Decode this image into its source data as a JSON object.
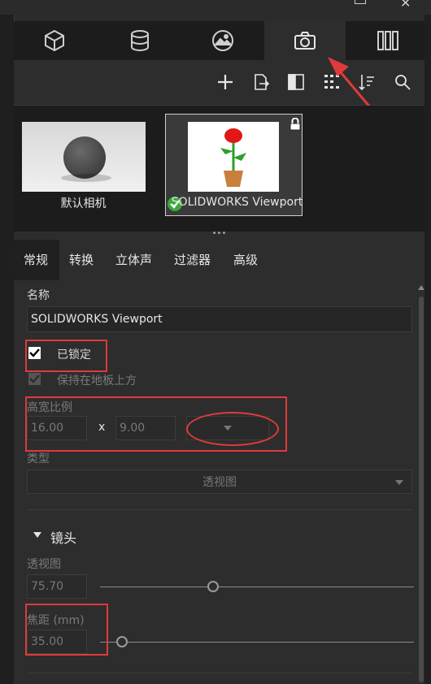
{
  "top_tabs": [
    {
      "name": "model-tab",
      "icon": "cube-icon"
    },
    {
      "name": "materials-tab",
      "icon": "cylinder-icon"
    },
    {
      "name": "environment-tab",
      "icon": "landscape-icon"
    },
    {
      "name": "cameras-tab",
      "icon": "camera-icon",
      "active": true
    },
    {
      "name": "library-tab",
      "icon": "library-icon"
    }
  ],
  "toolbar": {
    "icons": [
      "plus-icon",
      "export-icon",
      "split-view-icon",
      "tree-icon",
      "sort-icon",
      "search-icon"
    ]
  },
  "thumbnails": [
    {
      "label": "默认相机",
      "selected": false
    },
    {
      "label": "SOLIDWORKS Viewport",
      "selected": true,
      "locked": true
    }
  ],
  "prop_tabs": [
    "常规",
    "转换",
    "立体声",
    "过滤器",
    "高级"
  ],
  "general": {
    "name_label": "名称",
    "name_value": "SOLIDWORKS Viewport",
    "locked_label": "已锁定",
    "keep_floor_label": "保持在地板上方",
    "aspect_label": "高宽比例",
    "aspect_w": "16.00",
    "aspect_x": "x",
    "aspect_h": "9.00",
    "type_label": "类型",
    "type_value": "透视图",
    "lens_section": "镜头",
    "perspective_label": "透视图",
    "perspective_value": "75.70",
    "perspective_level": 0.36,
    "focal_label": "焦距 (mm)",
    "focal_value": "35.00",
    "focal_level": 0.07
  },
  "colors": {
    "accent_red": "#e03a3a",
    "check_green": "#3aa83a"
  }
}
